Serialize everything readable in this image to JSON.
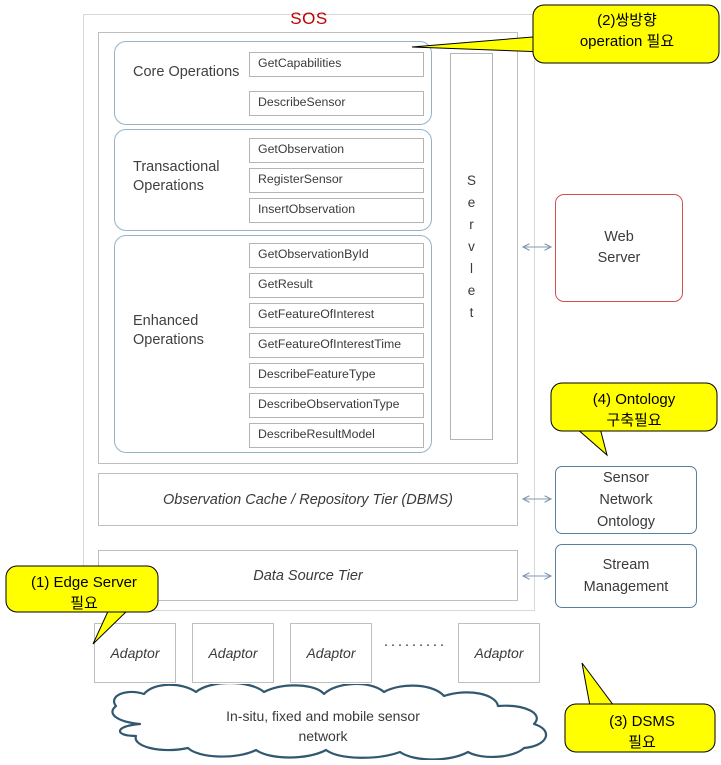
{
  "diagram": {
    "title": "SOS",
    "title_color": "#c00000"
  },
  "operations": {
    "groups": [
      {
        "label": "Core\nOperations",
        "items": [
          "GetCapabilities",
          "DescribeSensor"
        ]
      },
      {
        "label": "Transactional\nOperations",
        "items": [
          "GetObservation",
          "RegisterSensor",
          "InsertObservation"
        ]
      },
      {
        "label": "Enhanced\nOperations",
        "items": [
          "GetObservationById",
          "GetResult",
          "GetFeatureOfInterest",
          "GetFeatureOfInterestTime",
          "DescribeFeatureType",
          "DescribeObservationType",
          "DescribeResultModel"
        ]
      }
    ]
  },
  "servlet": {
    "label": "S\ne\nr\nv\nl\ne\nt"
  },
  "tiers": [
    {
      "label": "Observation Cache / Repository Tier (DBMS)"
    },
    {
      "label": "Data Source Tier"
    }
  ],
  "side_boxes": {
    "web_server": {
      "label": "Web\nServer",
      "color": "#d0504f"
    },
    "sensor_ontology": {
      "label": "Sensor\nNetwork\nOntology",
      "color": "#5a7f9c"
    },
    "stream_management": {
      "label": "Stream\nManagement",
      "color": "#5a7f9c"
    }
  },
  "adaptors": {
    "boxes": [
      "Adaptor",
      "Adaptor",
      "Adaptor",
      "Adaptor"
    ],
    "ellipsis": "·········"
  },
  "cloud": {
    "label": "In-situ, fixed and mobile sensor\nnetwork",
    "color": "#31586f"
  },
  "callouts": [
    {
      "id": "1",
      "text": "(1) Edge Server\n필요",
      "fill": "#ffff00"
    },
    {
      "id": "2",
      "text": "(2)쌍방향\noperation 필요",
      "fill": "#ffff00"
    },
    {
      "id": "3",
      "text": "(3) DSMS\n필요",
      "fill": "#ffff00"
    },
    {
      "id": "4",
      "text": "(4) Ontology\n구축필요",
      "fill": "#ffff00"
    }
  ],
  "connectors": {
    "color": "#8497b0",
    "arrows": [
      {
        "name": "servlet-to-web-server"
      },
      {
        "name": "cache-tier-to-sensor-ontology"
      },
      {
        "name": "data-tier-to-stream-management"
      }
    ]
  }
}
